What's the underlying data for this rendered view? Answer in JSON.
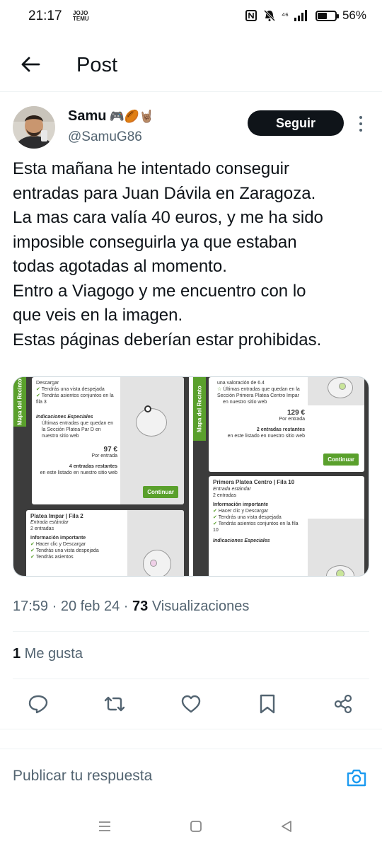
{
  "status_bar": {
    "time": "21:17",
    "carrier_small_line1": "JOJO",
    "carrier_small_line2": "TEMU",
    "network": "⁴⁶",
    "battery_level": 0.56,
    "battery_label": "56%"
  },
  "header": {
    "title": "Post"
  },
  "author": {
    "name": "Samu",
    "emojis": "🎮🏉🤘🏽",
    "handle": "@SamuG86"
  },
  "follow_label": "Seguir",
  "tweet": {
    "lines": [
      "Esta mañana he intentado conseguir",
      "entradas para Juan Dávila en Zaragoza.",
      "La mas cara valía 40 euros, y me ha sido",
      "imposible conseguirla ya que estaban",
      "todas agotadas al momento.",
      "Entro a Viagogo y me encuentro con lo",
      "que veis en la imagen.",
      "Estas páginas deberían estar prohibidas."
    ]
  },
  "media": {
    "left": {
      "tab_label": "Mapa del Recinto",
      "card1": {
        "line1": "Descargar",
        "line2": "Tendrás una vista despejada",
        "line3": "Tendrás asientos conjuntos en la fila 3",
        "section_title": "Indicaciones Especiales",
        "note": "Últimas entradas que quedan en la Sección Platea Par D en nuestro sitio web",
        "price": "97 €",
        "price_sub": "Por entrada",
        "remaining": "4 entradas restantes",
        "remaining_sub": "en este listado en nuestro sitio web",
        "button": "Continuar"
      },
      "card2": {
        "title": "Platea Impar | Fila 2",
        "subtitle": "Entrada estándar",
        "qty": "2 entradas",
        "info_title": "Información importante",
        "info1": "Hacer clic y Descargar",
        "info2": "Tendrás una vista despejada",
        "info3": "Tendrás asientos"
      }
    },
    "right": {
      "tab_label": "Mapa del Recinto",
      "card1": {
        "line1": "una valoración de 6.4",
        "line2": "Últimas entradas que quedan en la Sección Primera Platea Centro Impar",
        "line3": "en nuestro sitio web",
        "price": "129 €",
        "price_sub": "Por entrada",
        "remaining": "2 entradas restantes",
        "remaining_sub": "en este listado en nuestro sitio web",
        "button": "Continuar"
      },
      "card2": {
        "title": "Primera Platea Centro | Fila 10",
        "subtitle": "Entrada estándar",
        "qty": "2 entradas",
        "info_title": "Información importante",
        "info1": "Hacer clic y Descargar",
        "info2": "Tendrás una vista despejada",
        "info3": "Tendrás asientos conjuntos en la fila 10",
        "section_title": "Indicaciones Especiales"
      }
    }
  },
  "meta": {
    "time_date": "17:59 · 20 feb 24 · ",
    "views_count": "73",
    "views_label": " Visualizaciones"
  },
  "likes": {
    "count": "1",
    "label": " Me gusta"
  },
  "reply": {
    "placeholder": "Publicar tu respuesta"
  },
  "icons": {
    "back": "arrow-left-icon",
    "reply": "reply-icon",
    "retweet": "retweet-icon",
    "like": "heart-icon",
    "bookmark": "bookmark-icon",
    "share": "share-icon",
    "camera": "camera-icon"
  },
  "colors": {
    "accent": "#1d9bf0",
    "viagogo_green": "#5aa02c",
    "text_secondary": "#536471"
  }
}
